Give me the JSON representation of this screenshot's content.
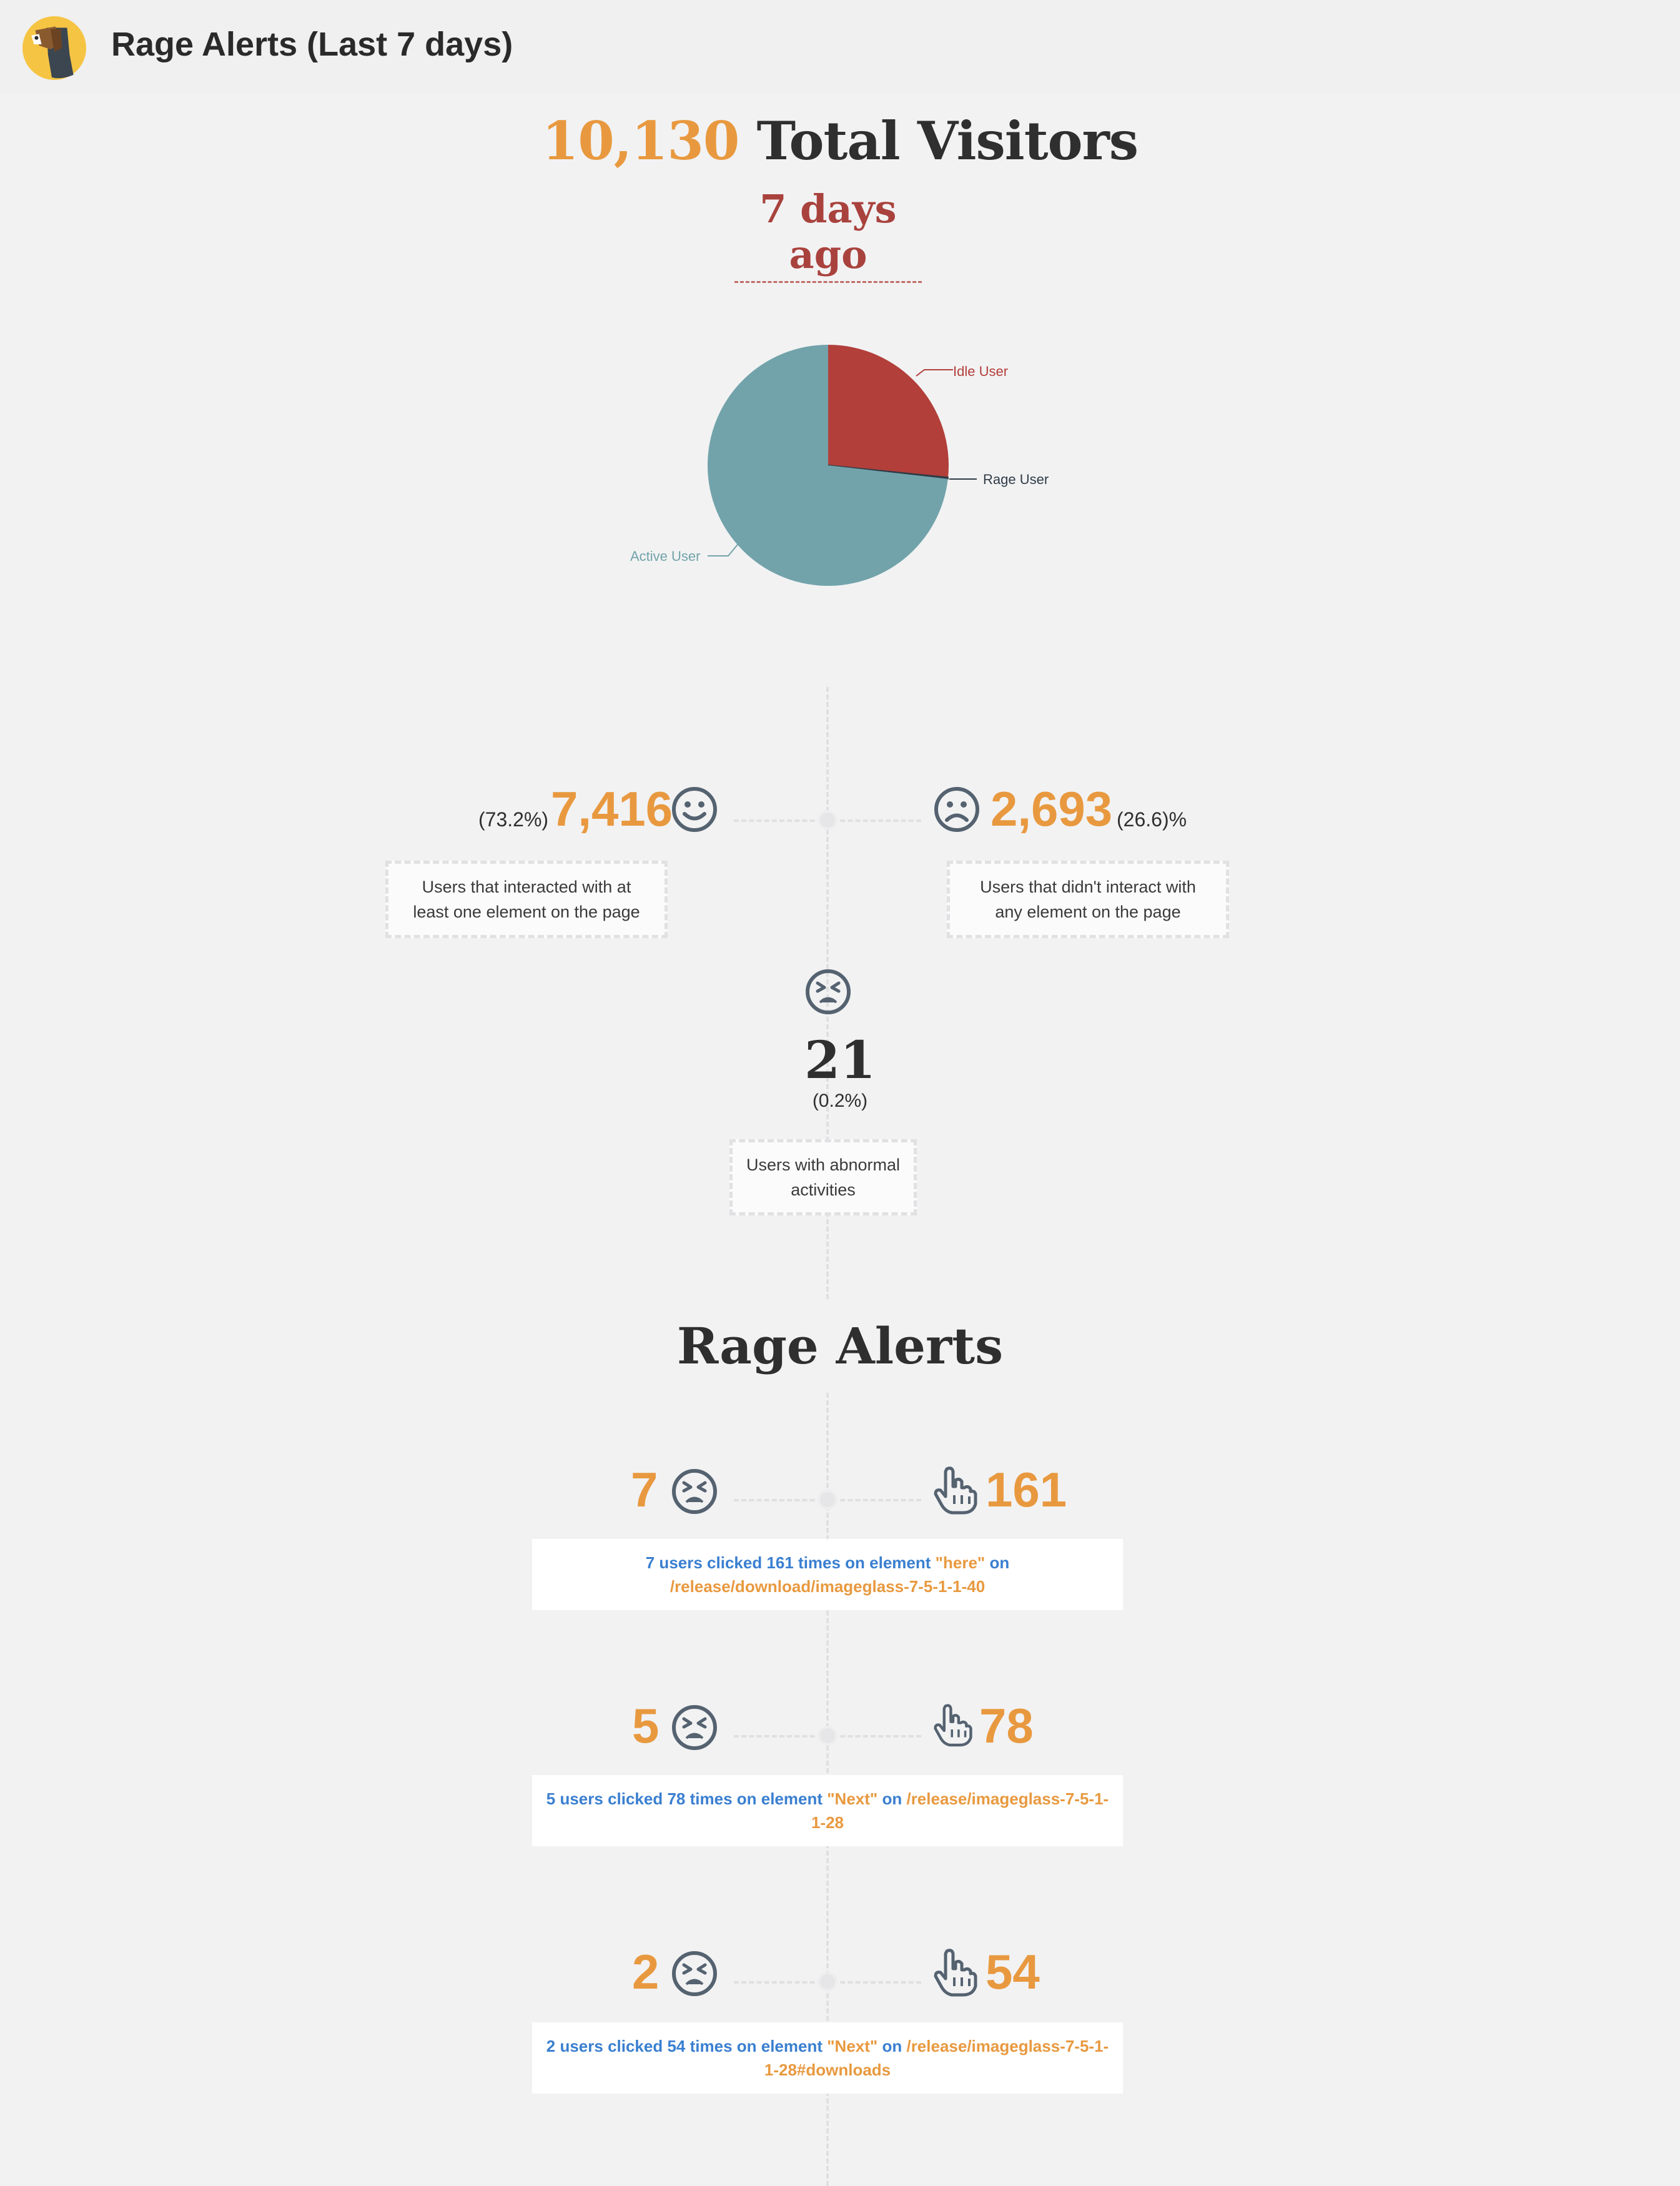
{
  "header": {
    "title": "Rage Alerts (Last 7 days)"
  },
  "summary": {
    "total_count": "10,130",
    "total_label": "Total Visitors",
    "period": "7 days ago"
  },
  "pie": {
    "labels": {
      "idle": "Idle User",
      "rage": "Rage User",
      "active": "Active User"
    },
    "shares": {
      "active": 73.2,
      "idle": 26.6,
      "rage": 0.2
    },
    "colors": {
      "active": "#72a3aa",
      "idle": "#b23f3a",
      "rage": "#2f3b46"
    }
  },
  "active_users": {
    "count": "7,416",
    "percent": "(73.2%)",
    "description": "Users that interacted with at least one element on the page"
  },
  "idle_users": {
    "count": "2,693",
    "percent": "(26.6)%",
    "description": "Users that didn't interact with any element on the page"
  },
  "rage_users": {
    "count": "21",
    "percent": "(0.2%)",
    "description": "Users with abnormal activities"
  },
  "alerts_section": {
    "title": "Rage Alerts"
  },
  "alerts": [
    {
      "users": "7",
      "clicks": "161",
      "text_start": "7 users clicked 161 times on element ",
      "element": "\"here\"",
      "text_on": " on ",
      "path": "/release/download/imageglass-7-5-1-1-40"
    },
    {
      "users": "5",
      "clicks": "78",
      "text_start": "5 users clicked 78 times on element ",
      "element": "\"Next\"",
      "text_on": " on ",
      "path": "/release/imageglass-7-5-1-1-28"
    },
    {
      "users": "2",
      "clicks": "54",
      "text_start": "2 users clicked 54 times on element ",
      "element": "\"Next\"",
      "text_on": " on ",
      "path": "/release/imageglass-7-5-1-1-28#downloads"
    }
  ],
  "icons": {
    "logo": "dog-logo-icon",
    "smile": "smile-icon",
    "frown": "frown-icon",
    "angry": "angry-face-icon",
    "click": "pointer-hand-icon"
  }
}
